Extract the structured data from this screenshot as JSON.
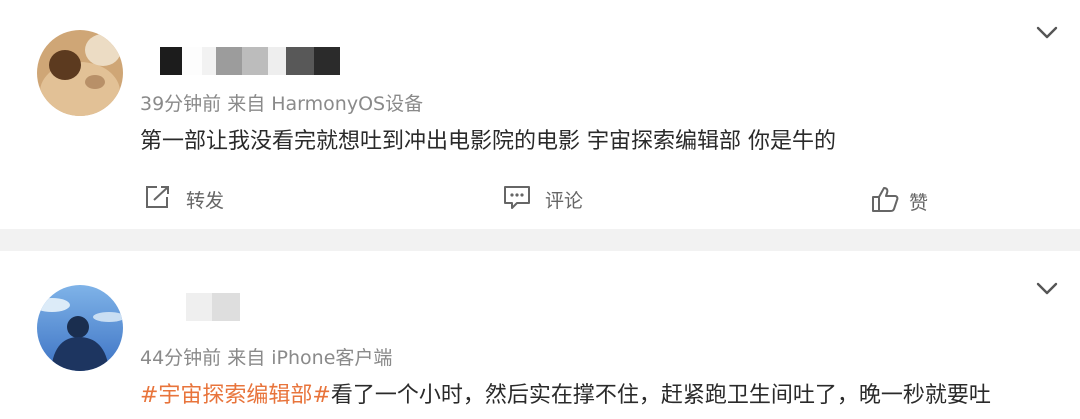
{
  "posts": [
    {
      "meta": "39分钟前  来自 HarmonyOS设备",
      "text": "第一部让我没看完就想吐到冲出电影院的电影 宇宙探索编辑部 你是牛的",
      "actions": {
        "repost": "转发",
        "comment": "评论",
        "like": "赞"
      }
    },
    {
      "meta": "44分钟前  来自 iPhone客户端",
      "hashtag": "#宇宙探索编辑部#",
      "text": "看了一个小时，然后实在撑不住，赶紧跑卫生间吐了，晚一秒就要吐"
    }
  ],
  "icons": {
    "expand": "chevron-down-icon",
    "repost": "share-icon",
    "comment": "comment-icon",
    "like": "thumbs-up-icon"
  },
  "colors": {
    "hashtag": "#e8743b",
    "meta_text": "#8a8a8a",
    "body_text": "#2a2a2a",
    "page_background": "#f2f2f2"
  }
}
